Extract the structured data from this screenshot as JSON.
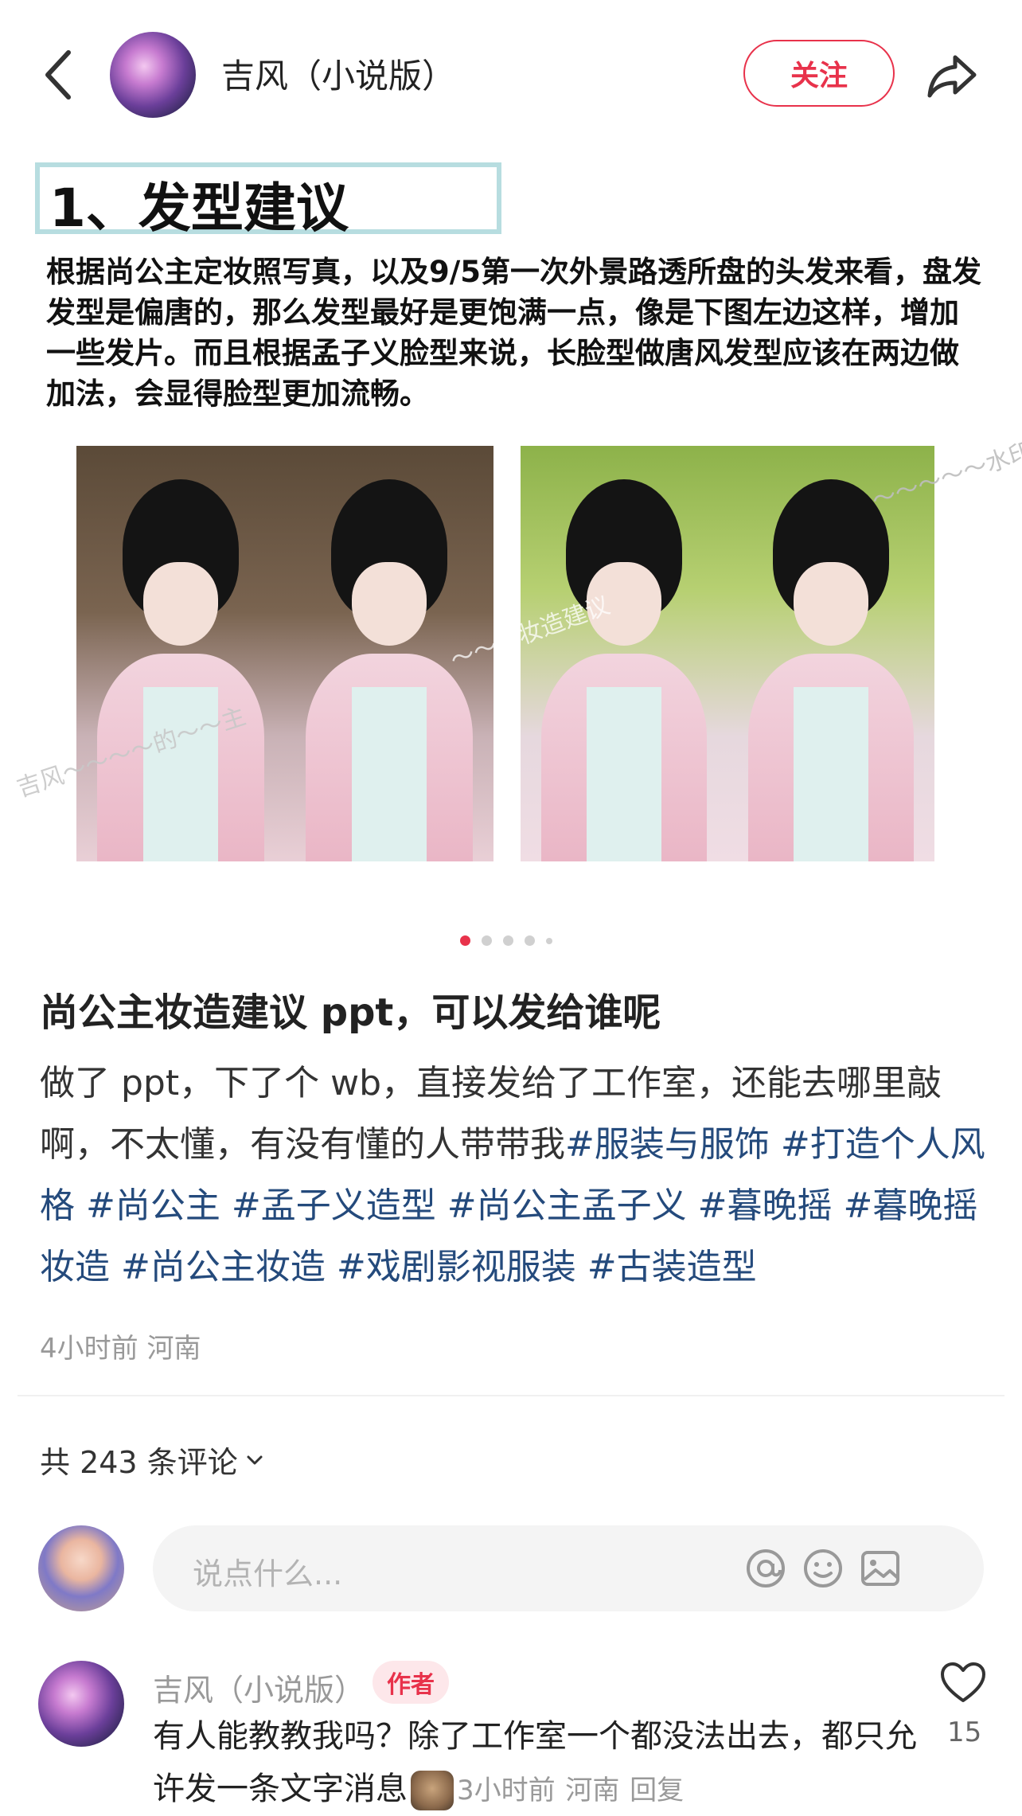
{
  "header": {
    "author_name": "吉风（小说版）",
    "follow_label": "关注",
    "back_icon": "back-arrow-icon",
    "share_icon": "share-icon"
  },
  "post_image": {
    "heading": "1、发型建议",
    "body": "根据尚公主定妆照写真，以及9/5第一次外景路透所盘的头发来看，盘发发型是偏唐的，那么发型最好是更饱满一点，像是下图左边这样，增加一些发片。而且根据孟子义脸型来说，长脸型做唐风发型应该在两边做加法，会显得脸型更加流畅。",
    "watermarks": [
      "吉风～～～～的～～主",
      "～～～妆造建议",
      "～～～～～水印～"
    ]
  },
  "pagination": {
    "total": 5,
    "active": 1
  },
  "post": {
    "title": "尚公主妆造建议 ppt，可以发给谁呢",
    "body_text": "做了 ppt，下了个 wb，直接发给了工作室，还能去哪里敲啊，不太懂，有没有懂的人带带我",
    "tags": [
      "#服装与服饰",
      "#打造个人风格",
      "#尚公主",
      "#孟子义造型",
      "#尚公主孟子义",
      "#暮晚摇",
      "#暮晚摇妆造",
      "#尚公主妆造",
      "#戏剧影视服装",
      "#古装造型"
    ],
    "meta": "4小时前 河南"
  },
  "comments": {
    "count_label": "共 243 条评论",
    "input_placeholder": "说点什么...",
    "items": [
      {
        "name": "吉风（小说版）",
        "badge": "作者",
        "text_part1": "有人能教教我吗？除了工作室一个都没法出去，都只允许发一条文字消息",
        "time": "3小时前",
        "location": "河南",
        "reply_label": "回复",
        "likes": "15"
      }
    ]
  },
  "colors": {
    "accent": "#e8324b",
    "tag": "#244a7c",
    "meta": "#999999"
  }
}
